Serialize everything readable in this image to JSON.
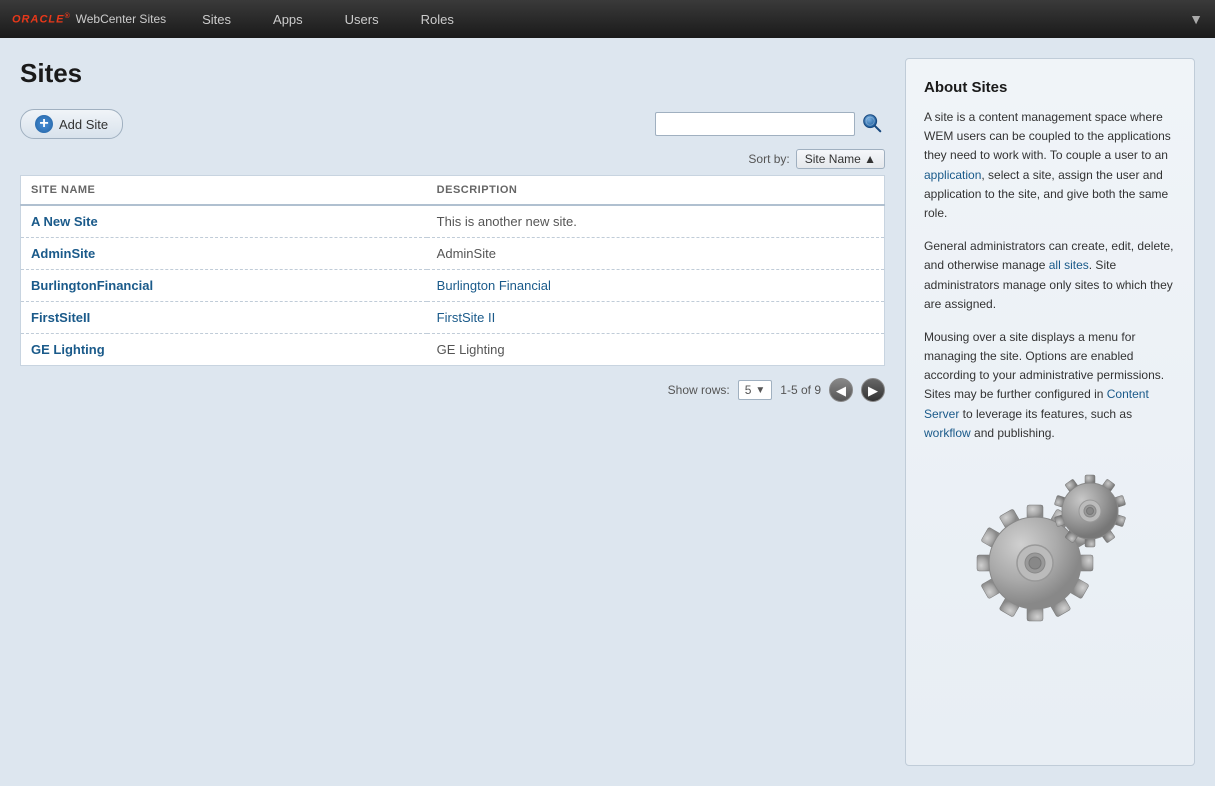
{
  "app": {
    "brand_oracle": "ORACLE",
    "brand_product": "WebCenter Sites"
  },
  "nav": {
    "items": [
      {
        "label": "Sites",
        "id": "sites"
      },
      {
        "label": "Apps",
        "id": "apps"
      },
      {
        "label": "Users",
        "id": "users"
      },
      {
        "label": "Roles",
        "id": "roles"
      }
    ]
  },
  "page": {
    "title": "Sites"
  },
  "toolbar": {
    "add_site_label": "Add Site",
    "search_placeholder": ""
  },
  "sort": {
    "label": "Sort by:",
    "value": "Site Name ▲"
  },
  "table": {
    "columns": [
      {
        "key": "site_name",
        "label": "SITE NAME"
      },
      {
        "key": "description",
        "label": "DESCRIPTION"
      }
    ],
    "rows": [
      {
        "name": "A New Site",
        "description": "This is another new site.",
        "desc_is_link": false
      },
      {
        "name": "AdminSite",
        "description": "AdminSite",
        "desc_is_link": false
      },
      {
        "name": "BurlingtonFinancial",
        "description": "Burlington Financial",
        "desc_is_link": true
      },
      {
        "name": "FirstSiteII",
        "description": "FirstSite II",
        "desc_is_link": true
      },
      {
        "name": "GE Lighting",
        "description": "GE Lighting",
        "desc_is_link": false
      }
    ]
  },
  "pagination": {
    "show_rows_label": "Show rows:",
    "rows_value": "5",
    "page_info": "1-5 of 9"
  },
  "about": {
    "title": "About Sites",
    "paragraph1": "A site is a content management space where WEM users can be coupled to the applications they need to work with. To couple a user to an application, select a site, assign the user and application to the site, and give both the same role.",
    "paragraph2": "General administrators can create, edit, delete, and otherwise manage all sites. Site administrators manage only sites to which they are assigned.",
    "paragraph3": "Mousing over a site displays a menu for managing the site. Options are enabled according to your administrative permissions. Sites may be further configured in Content Server to leverage its features, such as workflow and publishing."
  }
}
